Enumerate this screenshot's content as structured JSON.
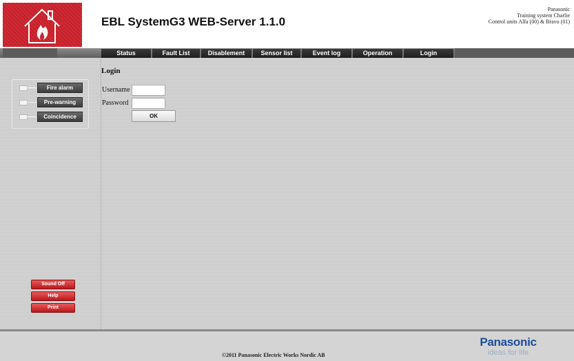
{
  "header": {
    "title": "EBL SystemG3 WEB-Server 1.1.0",
    "info_line1": "Panasonic",
    "info_line2": "Training system Charlie",
    "info_line3": "Control units Alfa (00) & Bravo (01)",
    "logo_icon": "house-fire-icon"
  },
  "nav": {
    "tabs": [
      {
        "label": "Status"
      },
      {
        "label": "Fault List"
      },
      {
        "label": "Disablement"
      },
      {
        "label": "Sensor list"
      },
      {
        "label": "Event log"
      },
      {
        "label": "Operation"
      },
      {
        "label": "Login"
      }
    ]
  },
  "sidebar": {
    "indicators": [
      {
        "label": "Fire alarm"
      },
      {
        "label": "Pre-warning"
      },
      {
        "label": "Coincidence"
      }
    ],
    "actions": [
      {
        "label": "Sound Off"
      },
      {
        "label": "Help"
      },
      {
        "label": "Print"
      }
    ]
  },
  "login": {
    "heading": "Login",
    "username_label": "Username",
    "password_label": "Password",
    "username_value": "",
    "password_value": "",
    "ok_label": "OK"
  },
  "footer": {
    "copyright": "©2011 Panasonic Electric Works Nordic AB",
    "brand_name": "Panasonic",
    "brand_tagline": "ideas for life"
  },
  "colors": {
    "brand_red": "#c8202a",
    "nav_dark": "#1e1e1e",
    "brand_blue": "#1b4f9c"
  }
}
